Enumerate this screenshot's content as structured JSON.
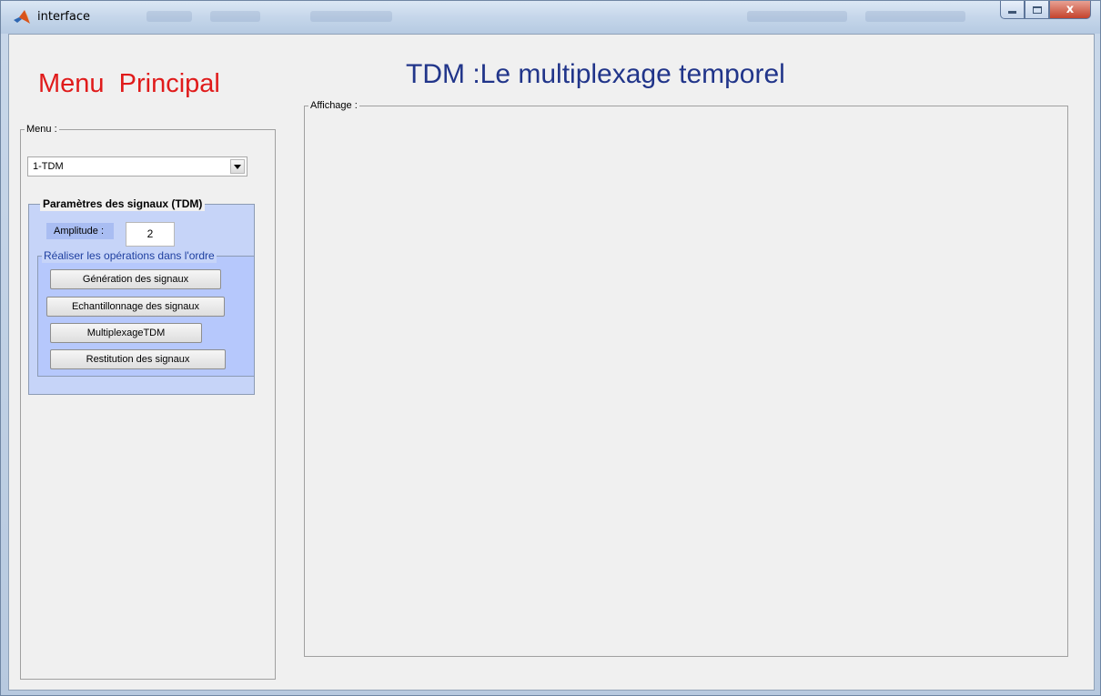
{
  "window": {
    "title": "interface",
    "close_label": "x"
  },
  "header": {
    "menu_title": "Menu  Principal",
    "main_title": "TDM :Le multiplexage temporel"
  },
  "menu_panel": {
    "label": "Menu :",
    "select_value": "1-TDM"
  },
  "params_panel": {
    "label": "Paramètres des signaux (TDM)",
    "amplitude_label": "Amplitude :",
    "amplitude_value": "2",
    "ops_label": "Réaliser les opérations dans l'ordre",
    "buttons": {
      "generation": "Génération des signaux",
      "sampling": "Echantillonnage des signaux",
      "multiplexing": "MultiplexageTDM",
      "restitution": "Restitution des signaux"
    }
  },
  "display_panel": {
    "label": "Affichage :"
  },
  "colors": {
    "menu_title": "#e01b1b",
    "main_title": "#21358a",
    "params_bg": "#c6d4f8",
    "ops_bg": "#b6c8fc"
  }
}
